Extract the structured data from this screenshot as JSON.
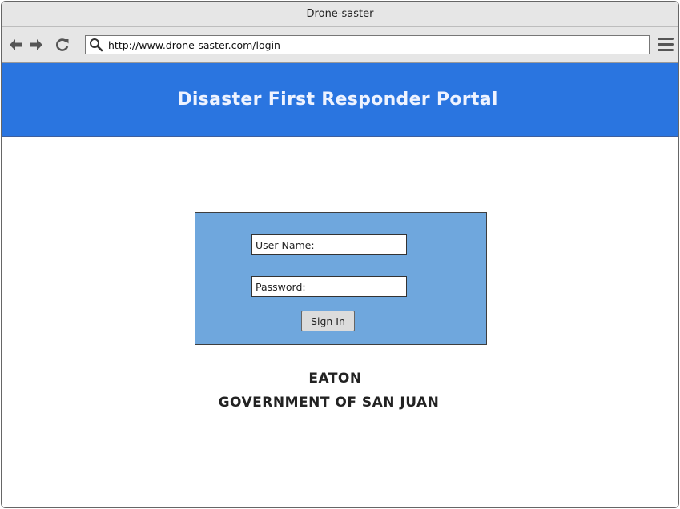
{
  "window": {
    "title": "Drone-saster"
  },
  "browser": {
    "url": "http://www.drone-saster.com/login",
    "icons": {
      "back": "arrow-left-icon",
      "forward": "arrow-right-icon",
      "reload": "reload-icon",
      "search": "search-icon",
      "menu": "hamburger-menu-icon"
    }
  },
  "header": {
    "title": "Disaster First Responder Portal"
  },
  "login": {
    "username_placeholder": "User Name:",
    "password_placeholder": "Password:",
    "signin_label": "Sign In"
  },
  "footer": {
    "line1": "EATON",
    "line2": "GOVERNMENT OF SAN JUAN"
  },
  "colors": {
    "header_bg": "#2a75e0",
    "panel_bg": "#6fa7dd",
    "chrome_bg": "#e6e6e6"
  }
}
